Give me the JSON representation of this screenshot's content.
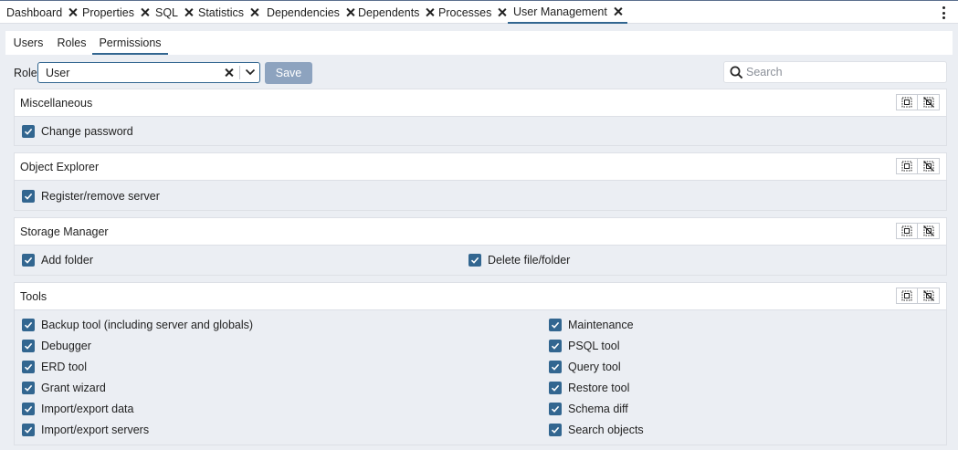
{
  "tabs": [
    {
      "label": "Dashboard"
    },
    {
      "label": "Properties"
    },
    {
      "label": "SQL"
    },
    {
      "label": "Statistics"
    },
    {
      "label": "Dependencies"
    },
    {
      "label": "Dependents"
    },
    {
      "label": "Processes"
    },
    {
      "label": "User Management",
      "active": true
    }
  ],
  "subtabs": [
    {
      "label": "Users"
    },
    {
      "label": "Roles"
    },
    {
      "label": "Permissions",
      "active": true
    }
  ],
  "toolbar": {
    "role_label": "Role",
    "role_value": "User",
    "save_label": "Save",
    "search_placeholder": "Search"
  },
  "sections": [
    {
      "title": "Miscellaneous",
      "items": [
        {
          "label": "Change password",
          "checked": true
        }
      ]
    },
    {
      "title": "Object Explorer",
      "items": [
        {
          "label": "Register/remove server",
          "checked": true
        }
      ]
    },
    {
      "title": "Storage Manager",
      "items": [
        {
          "label": "Add folder",
          "checked": true
        },
        {
          "label": "Delete file/folder",
          "checked": true
        }
      ]
    },
    {
      "title": "Tools",
      "items": [
        {
          "label": "Backup tool (including server and globals)",
          "checked": true
        },
        {
          "label": "Debugger",
          "checked": true
        },
        {
          "label": "ERD tool",
          "checked": true
        },
        {
          "label": "Grant wizard",
          "checked": true
        },
        {
          "label": "Import/export data",
          "checked": true
        },
        {
          "label": "Import/export servers",
          "checked": true
        },
        {
          "label": "Maintenance",
          "checked": true
        },
        {
          "label": "PSQL tool",
          "checked": true
        },
        {
          "label": "Query tool",
          "checked": true
        },
        {
          "label": "Restore tool",
          "checked": true
        },
        {
          "label": "Schema diff",
          "checked": true
        },
        {
          "label": "Search objects",
          "checked": true
        }
      ]
    }
  ],
  "colors": {
    "accent": "#326690",
    "panel_bg": "#ebeef3",
    "save_disabled": "#8da3bf"
  },
  "icons": {
    "tab_close": "close-icon",
    "menu": "kebab-menu-icon",
    "clear": "clear-icon",
    "dropdown": "chevron-down-icon",
    "search": "search-icon",
    "select_all": "select-all-icon",
    "deselect_all": "deselect-all-icon",
    "checkbox": "checkbox-checked-icon"
  }
}
